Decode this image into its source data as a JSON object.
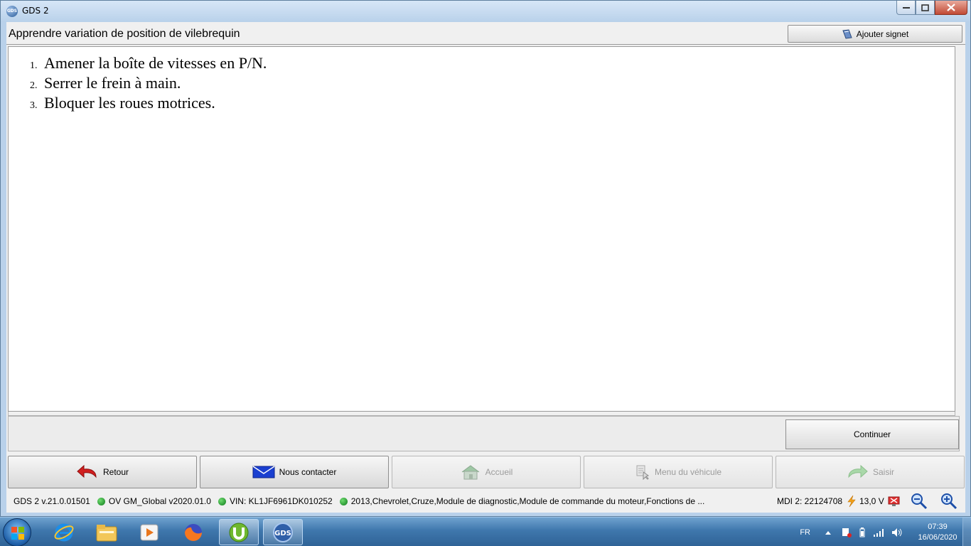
{
  "window": {
    "title": "GDS 2",
    "icon_text": "GDS"
  },
  "header": {
    "title": "Apprendre variation de position de vilebrequin",
    "bookmark_label": "Ajouter signet"
  },
  "steps": [
    {
      "num": "1.",
      "text": "Amener la boîte de vitesses en P/N."
    },
    {
      "num": "2.",
      "text": "Serrer le frein à main."
    },
    {
      "num": "3.",
      "text": "Bloquer les roues motrices."
    }
  ],
  "actions": {
    "continue_label": "Continuer"
  },
  "nav": {
    "back": "Retour",
    "contact": "Nous contacter",
    "home": "Accueil",
    "vehicle_menu": "Menu du véhicule",
    "enter": "Saisir"
  },
  "status": {
    "version": "GDS 2 v.21.0.01501",
    "database": "OV GM_Global v2020.01.0",
    "vin": "VIN: KL1JF6961DK010252",
    "vehicle": "2013,Chevrolet,Cruze,Module de diagnostic,Module de commande du moteur,Fonctions de ...",
    "mdi": "MDI 2: 22124708",
    "voltage": "13,0 V",
    "status_color": "#1a9a2a"
  },
  "taskbar": {
    "language": "FR",
    "time": "07:39",
    "date": "16/06/2020"
  }
}
